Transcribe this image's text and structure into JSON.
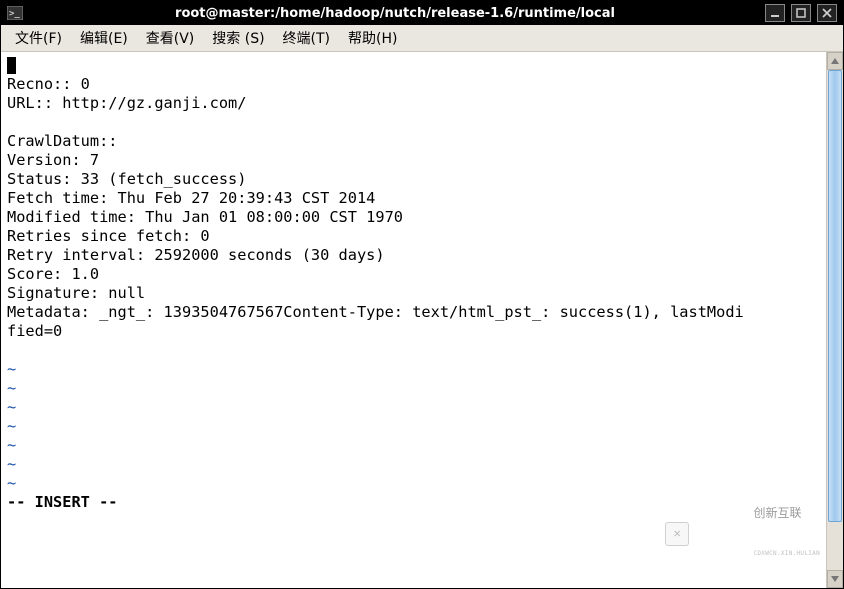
{
  "window": {
    "title": "root@master:/home/hadoop/nutch/release-1.6/runtime/local"
  },
  "menu": {
    "file": "文件(F)",
    "edit": "编辑(E)",
    "view": "查看(V)",
    "search": "搜索 (S)",
    "terminal": "终端(T)",
    "help": "帮助(H)"
  },
  "content": {
    "line_recno": "Recno:: 0",
    "line_url": "URL:: http://gz.ganji.com/",
    "line_heading": "CrawlDatum::",
    "line_version": "Version: 7",
    "line_status": "Status: 33 (fetch_success)",
    "line_fetch": "Fetch time: Thu Feb 27 20:39:43 CST 2014",
    "line_modified": "Modified time: Thu Jan 01 08:00:00 CST 1970",
    "line_retries": "Retries since fetch: 0",
    "line_interval": "Retry interval: 2592000 seconds (30 days)",
    "line_score": "Score: 1.0",
    "line_sig": "Signature: null",
    "line_meta1": "Metadata: _ngt_: 1393504767567Content-Type: text/html_pst_: success(1), lastModi",
    "line_meta2": "fied=0",
    "tilde": "~",
    "status": "-- INSERT --"
  },
  "watermark": {
    "text": "创新互联",
    "sub": "CDXWCN.XIN.HULIAN"
  }
}
